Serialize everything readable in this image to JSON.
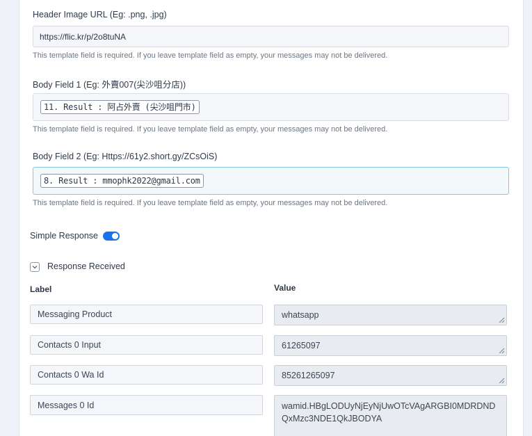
{
  "fields": [
    {
      "label": "Header Image URL (Eg: .png, .jpg)",
      "value": "https://flic.kr/p/2o8tuNA",
      "hint": "This template field is required. If you leave template field as empty, your messages may not be delivered."
    },
    {
      "label": "Body Field 1 (Eg: 外賣007(尖沙咀分店))",
      "token": "11. Result : 阿占外賣 (尖沙咀門市)",
      "hint": "This template field is required. If you leave template field as empty, your messages may not be delivered."
    },
    {
      "label": "Body Field 2 (Eg: Https://61y2.short.gy/ZCsOiS)",
      "token": "8. Result : mmophk2022@gmail.com",
      "hint": "This template field is required. If you leave template field as empty, your messages may not be delivered."
    }
  ],
  "simple_response": {
    "label": "Simple Response",
    "enabled": true
  },
  "response_received": {
    "title": "Response Received",
    "label_header": "Label",
    "value_header": "Value",
    "rows": [
      {
        "label": "Messaging Product",
        "value": "whatsapp"
      },
      {
        "label": "Contacts 0 Input",
        "value": "61265097"
      },
      {
        "label": "Contacts 0 Wa Id",
        "value": "85261265097"
      },
      {
        "label": "Messages 0 Id",
        "value": "wamid.HBgLODUyNjEyNjUwOTcVAgARGBI0MDRDNDQxMzc3NDE1QkJBODYA"
      }
    ]
  },
  "colors": {
    "accent": "#1a73e8",
    "active_border": "#7fc8e6"
  },
  "icons": {
    "toggle": "toggle-switch-icon",
    "collapse": "chevron-down-icon",
    "resize": "resize-handle-icon"
  }
}
